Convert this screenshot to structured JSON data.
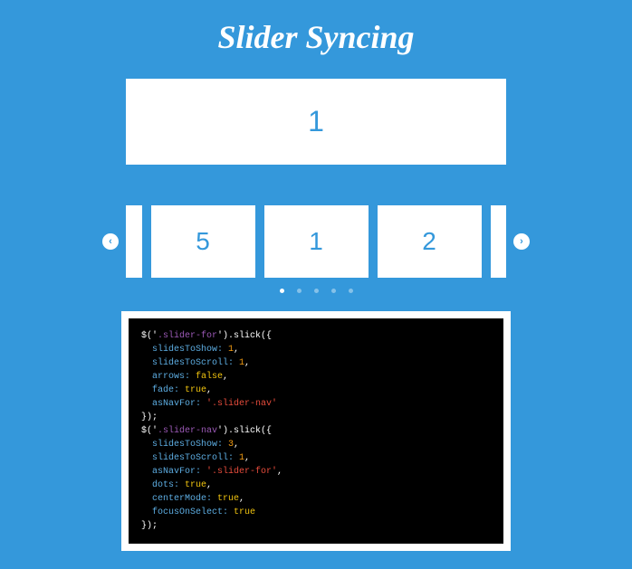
{
  "title": "Slider Syncing",
  "sliderFor": {
    "current": "1"
  },
  "sliderNav": {
    "partialLeft": "",
    "slides": [
      "5",
      "1",
      "2"
    ],
    "partialRight": ""
  },
  "dots": {
    "count": 5,
    "active": 0
  },
  "code": {
    "line1_a": "$('",
    "line1_b": ".slider-for",
    "line1_c": "').slick({",
    "line2_a": "slidesToShow: ",
    "line2_b": "1",
    "line2_c": ",",
    "line3_a": "slidesToScroll: ",
    "line3_b": "1",
    "line3_c": ",",
    "line4_a": "arrows: ",
    "line4_b": "false",
    "line4_c": ",",
    "line5_a": "fade: ",
    "line5_b": "true",
    "line5_c": ",",
    "line6_a": "asNavFor: ",
    "line6_b": "'.slider-nav'",
    "line7": "});",
    "line8_a": "$('",
    "line8_b": ".slider-nav",
    "line8_c": "').slick({",
    "line9_a": "slidesToShow: ",
    "line9_b": "3",
    "line9_c": ",",
    "line10_a": "slidesToScroll: ",
    "line10_b": "1",
    "line10_c": ",",
    "line11_a": "asNavFor: ",
    "line11_b": "'.slider-for'",
    "line11_c": ",",
    "line12_a": "dots: ",
    "line12_b": "true",
    "line12_c": ",",
    "line13_a": "centerMode: ",
    "line13_b": "true",
    "line13_c": ",",
    "line14_a": "focusOnSelect: ",
    "line14_b": "true",
    "line15": "});"
  },
  "chart_data": {
    "type": "table",
    "title": "Slider Syncing demo",
    "slider_for_visible": 1,
    "slider_nav_visible": [
      5,
      1,
      2
    ],
    "dot_count": 5,
    "active_dot_index": 0
  }
}
